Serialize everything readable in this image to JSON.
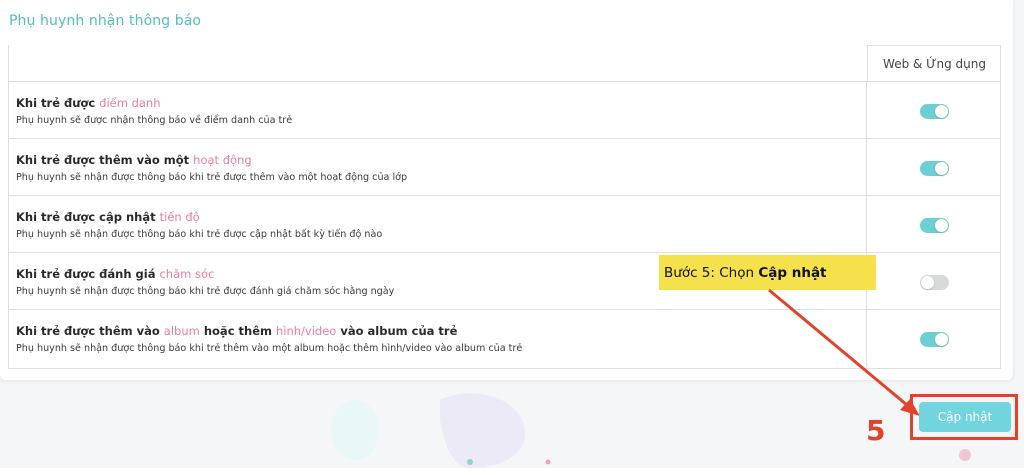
{
  "section": {
    "title": "Phụ huynh nhận thông báo",
    "column_header": "Web & Ứng dụng"
  },
  "rows": [
    {
      "title_prefix": "Khi trẻ được ",
      "title_highlight": "điểm danh",
      "title_suffix": "",
      "title_highlight2": "",
      "title_suffix2": "",
      "description": "Phụ huynh sẽ được nhận thông báo về điểm danh của trẻ",
      "enabled": true
    },
    {
      "title_prefix": "Khi trẻ được thêm vào một ",
      "title_highlight": "hoạt động",
      "title_suffix": "",
      "title_highlight2": "",
      "title_suffix2": "",
      "description": "Phụ huynh sẽ nhận được thông báo khi trẻ được thêm vào một hoạt động của lớp",
      "enabled": true
    },
    {
      "title_prefix": "Khi trẻ được cập nhật ",
      "title_highlight": "tiến độ",
      "title_suffix": "",
      "title_highlight2": "",
      "title_suffix2": "",
      "description": "Phụ huynh sẽ nhận được thông báo khi trẻ được cập nhật bất kỳ tiến độ nào",
      "enabled": true
    },
    {
      "title_prefix": "Khi trẻ được đánh giá ",
      "title_highlight": "chăm sóc",
      "title_suffix": "",
      "title_highlight2": "",
      "title_suffix2": "",
      "description": "Phụ huynh sẽ nhận được thông báo khi trẻ được đánh giá chăm sóc hằng ngày",
      "enabled": false
    },
    {
      "title_prefix": "Khi trẻ được thêm vào ",
      "title_highlight": "album",
      "title_suffix": " hoặc thêm ",
      "title_highlight2": "hình/video",
      "title_suffix2": " vào album của trẻ",
      "description": "Phụ huynh sẽ nhận được thông báo khi trẻ thêm vào một album hoặc thêm hình/video vào album của trẻ",
      "enabled": true
    }
  ],
  "annotation": {
    "callout_prefix": "Bước 5: ",
    "callout_action": "Chọn ",
    "callout_target": "Cập nhật",
    "step_number": "5"
  },
  "footer": {
    "update_button": "Cập nhật"
  },
  "colors": {
    "accent": "#56bcc4",
    "highlight": "#ec7da0",
    "toggle_on": "#6ccfd3",
    "toggle_off": "#d7d9dc",
    "callout_bg": "#f4e14b",
    "annotation_red": "#e3432d"
  }
}
